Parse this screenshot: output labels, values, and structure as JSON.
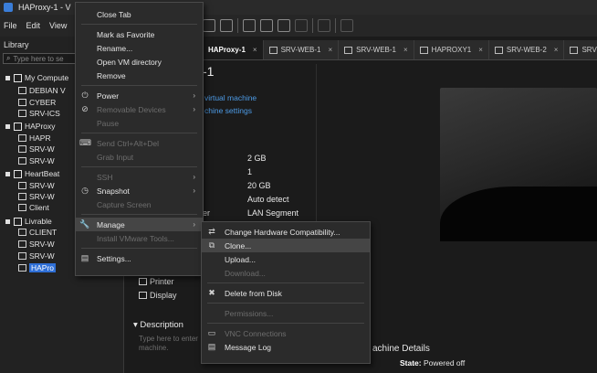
{
  "window": {
    "title": "HAProxy-1 - V"
  },
  "menubar": {
    "file": "File",
    "edit": "Edit",
    "view": "View"
  },
  "library": {
    "title": "Library",
    "search_placeholder": "Type here to se",
    "tree": [
      {
        "label": "My Compute",
        "kind": "group"
      },
      {
        "label": "DEBIAN V",
        "kind": "vm"
      },
      {
        "label": "CYBER",
        "kind": "vm"
      },
      {
        "label": "SRV-ICS",
        "kind": "vm"
      },
      {
        "label": "HAProxy",
        "kind": "group"
      },
      {
        "label": "HAPR",
        "kind": "vm"
      },
      {
        "label": "SRV-W",
        "kind": "vm"
      },
      {
        "label": "SRV-W",
        "kind": "vm"
      },
      {
        "label": "HeartBeat",
        "kind": "group"
      },
      {
        "label": "SRV-W",
        "kind": "vm"
      },
      {
        "label": "SRV-W",
        "kind": "vm"
      },
      {
        "label": "Client",
        "kind": "vm"
      },
      {
        "label": "Livrable",
        "kind": "group"
      },
      {
        "label": "CLIENT",
        "kind": "vm"
      },
      {
        "label": "SRV-W",
        "kind": "vm"
      },
      {
        "label": "SRV-W",
        "kind": "vm"
      },
      {
        "label": "HAPro",
        "kind": "vm",
        "selected": true
      }
    ]
  },
  "tabs": [
    {
      "label": "HAProxy-1",
      "active": true
    },
    {
      "label": "SRV-WEB-1"
    },
    {
      "label": "SRV-WEB-1"
    },
    {
      "label": "HAPROXY1"
    },
    {
      "label": "SRV-WEB-2"
    },
    {
      "label": "SRV"
    }
  ],
  "vm": {
    "title_suffix": "-1",
    "link_power": "virtual machine",
    "link_settings": "chine settings",
    "devices": [
      {
        "key": "",
        "value": "2 GB"
      },
      {
        "key": "",
        "value": "1"
      },
      {
        "key": "",
        "value": "20 GB"
      },
      {
        "key": "",
        "value": "Auto detect"
      },
      {
        "key": "er",
        "value": "LAN Segment"
      }
    ],
    "printer": "Printer",
    "display": "Display",
    "description_header": "Description",
    "description_hint": "Type here to enter\nmachine.",
    "details_header": "achine Details",
    "state_label": "State:",
    "state_value": "Powered off"
  },
  "context_menu": [
    {
      "label": "Close Tab"
    },
    {
      "sep": true
    },
    {
      "label": "Mark as Favorite"
    },
    {
      "label": "Rename..."
    },
    {
      "label": "Open VM directory"
    },
    {
      "label": "Remove"
    },
    {
      "sep": true
    },
    {
      "label": "Power",
      "icon": "power-icon",
      "glyph": "⏻",
      "submenu": true
    },
    {
      "label": "Removable Devices",
      "icon": "removable-devices-icon",
      "glyph": "⊘",
      "submenu": true,
      "disabled": true
    },
    {
      "label": "Pause",
      "disabled": true
    },
    {
      "sep": true
    },
    {
      "label": "Send Ctrl+Alt+Del",
      "icon": "keyboard-icon",
      "glyph": "⌨",
      "disabled": true
    },
    {
      "label": "Grab Input",
      "disabled": true
    },
    {
      "sep": true
    },
    {
      "label": "SSH",
      "submenu": true,
      "disabled": true
    },
    {
      "label": "Snapshot",
      "icon": "snapshot-icon",
      "glyph": "◷",
      "submenu": true
    },
    {
      "label": "Capture Screen",
      "disabled": true
    },
    {
      "sep": true
    },
    {
      "label": "Manage",
      "icon": "wrench-icon",
      "glyph": "🔧",
      "submenu": true,
      "highlight": true
    },
    {
      "label": "Install VMware Tools...",
      "disabled": true
    },
    {
      "sep": true
    },
    {
      "label": "Settings...",
      "icon": "settings-icon",
      "glyph": "▤"
    }
  ],
  "submenu": [
    {
      "label": "Change Hardware Compatibility...",
      "icon": "hardware-compat-icon",
      "glyph": "⇄"
    },
    {
      "label": "Clone...",
      "icon": "clone-icon",
      "glyph": "⧉",
      "highlight": true
    },
    {
      "label": "Upload..."
    },
    {
      "label": "Download...",
      "disabled": true
    },
    {
      "sep": true
    },
    {
      "label": "Delete from Disk",
      "icon": "delete-icon",
      "glyph": "✖"
    },
    {
      "sep": true
    },
    {
      "label": "Permissions...",
      "disabled": true
    },
    {
      "sep": true
    },
    {
      "label": "VNC Connections",
      "icon": "vnc-icon",
      "glyph": "▭",
      "disabled": true
    },
    {
      "label": "Message Log",
      "icon": "message-log-icon",
      "glyph": "▤"
    }
  ]
}
